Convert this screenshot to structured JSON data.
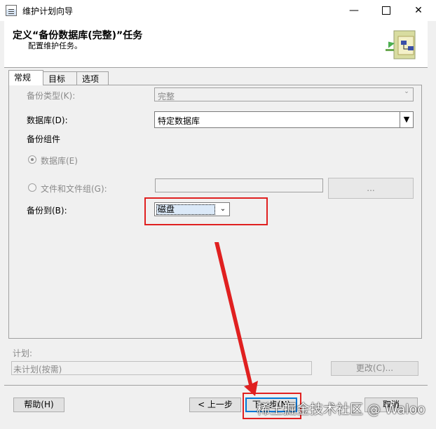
{
  "window": {
    "title": "维护计划向导",
    "minimize": "—",
    "maximize": "",
    "close": "✕"
  },
  "header": {
    "title": "定义“备份数据库(完整)”任务",
    "subtitle": "配置维护任务。",
    "icon": "wizard-banner-icon"
  },
  "tabs": [
    {
      "label": "常规",
      "active": true
    },
    {
      "label": "目标",
      "active": false
    },
    {
      "label": "选项",
      "active": false
    }
  ],
  "form": {
    "backup_type_label": "备份类型(K):",
    "backup_type_value": "完整",
    "database_label": "数据库(D):",
    "database_value": "特定数据库",
    "component_label": "备份组件",
    "radio_database": "数据库(E)",
    "radio_files": "文件和文件组(G):",
    "browse_label": "...",
    "backup_to_label": "备份到(B):",
    "backup_to_value": "磁盘"
  },
  "schedule": {
    "label": "计划:",
    "value": "未计划(按需)",
    "change_label": "更改(C)..."
  },
  "buttons": {
    "help": "帮助(H)",
    "back": "< 上一步",
    "next": "下一步(N)",
    "cancel": "取消"
  },
  "watermark": "稀土掘金技术社区 @ Waloo",
  "colors": {
    "highlight_box": "#e02020",
    "default_button_border": "#0078d7"
  }
}
